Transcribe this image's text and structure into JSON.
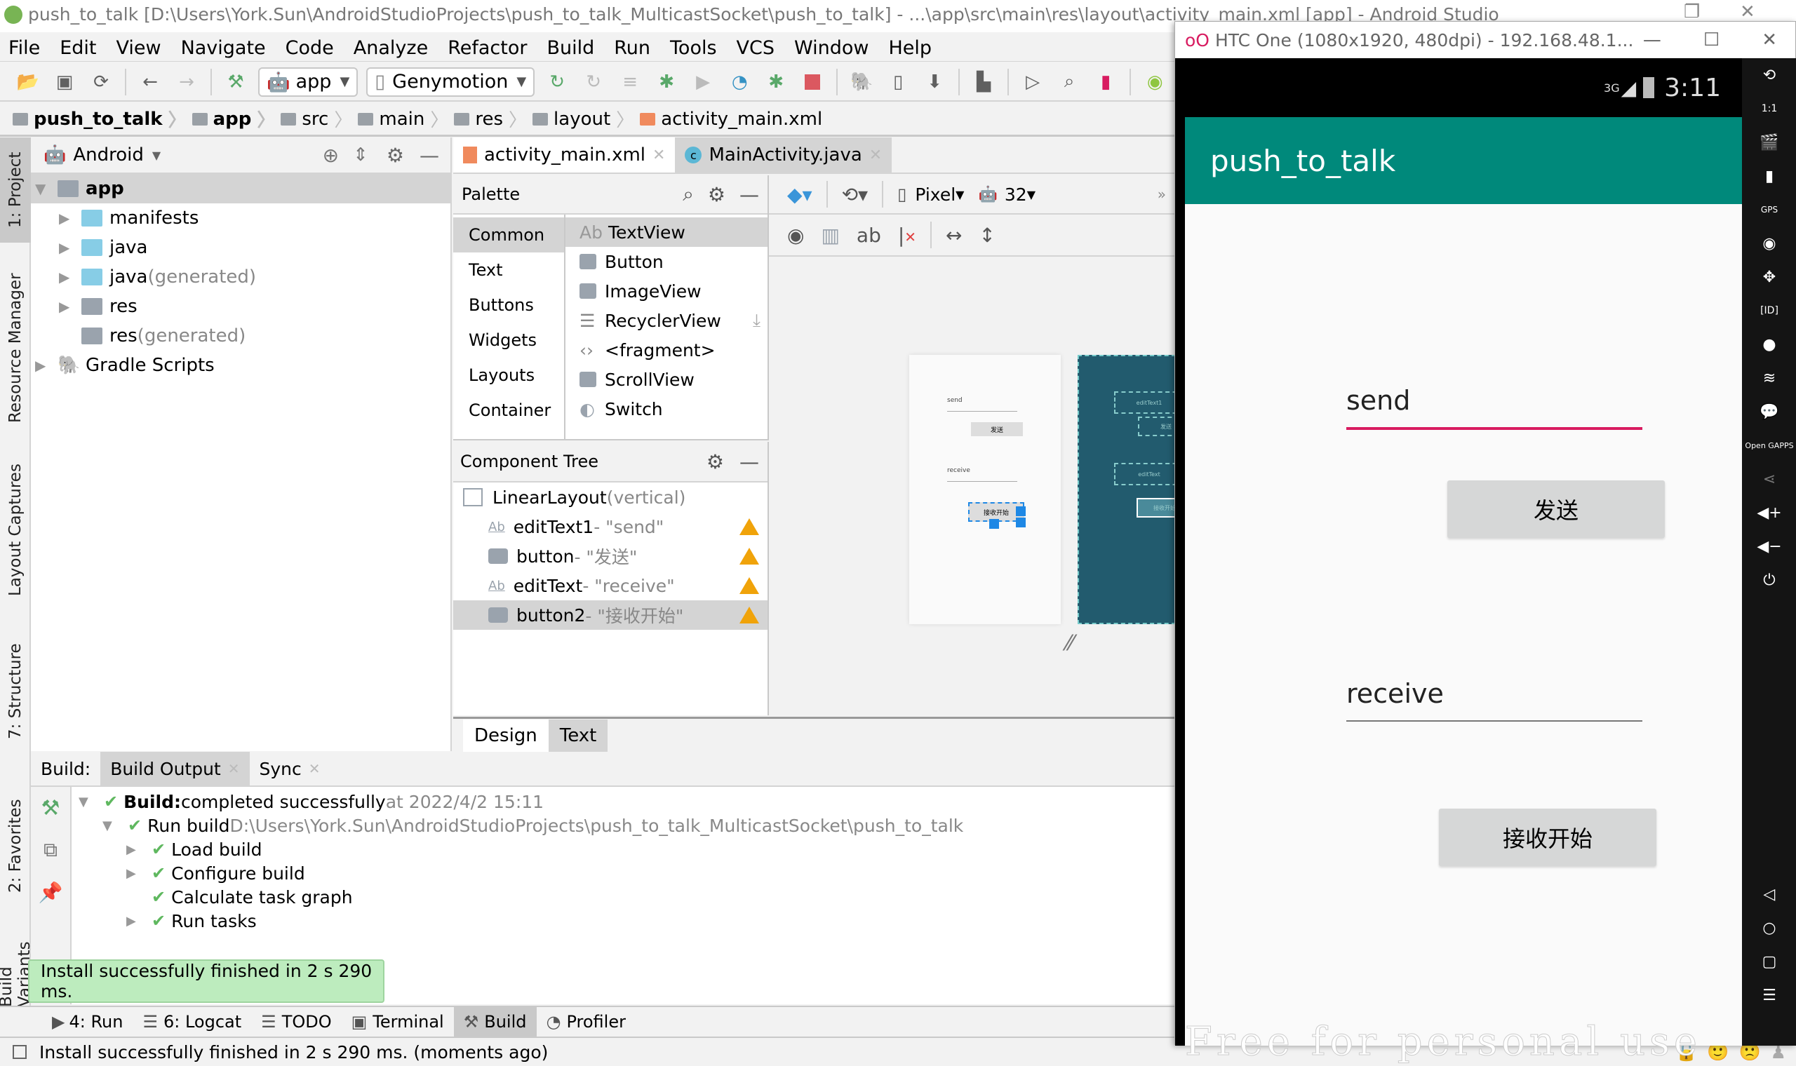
{
  "window": {
    "title": "push_to_talk [D:\\Users\\York.Sun\\AndroidStudioProjects\\push_to_talk_MulticastSocket\\push_to_talk] - ...\\app\\src\\main\\res\\layout\\activity_main.xml [app] - Android Studio"
  },
  "menu": [
    "File",
    "Edit",
    "View",
    "Navigate",
    "Code",
    "Analyze",
    "Refactor",
    "Build",
    "Run",
    "Tools",
    "VCS",
    "Window",
    "Help"
  ],
  "toolbar": {
    "run_config": "app",
    "device": "Genymotion",
    "icons": [
      "open-icon",
      "save-icon",
      "sync-icon",
      "back-icon",
      "forward-icon",
      "build-hammer-icon",
      "apply-changes-icon",
      "apply-code-changes-icon",
      "attach-icon",
      "debug-icon",
      "run-coverage-icon",
      "profile-icon",
      "attach-debugger-icon",
      "stop-icon",
      "gradle-sync-icon",
      "avd-manager-icon",
      "sdk-manager-icon",
      "project-structure-icon",
      "terminal-run-icon",
      "search-icon",
      "device-file-explorer-icon",
      "android-assistant-icon"
    ]
  },
  "breadcrumb": [
    "push_to_talk",
    "app",
    "src",
    "main",
    "res",
    "layout",
    "activity_main.xml"
  ],
  "left_stripe": [
    "1: Project",
    "Resource Manager",
    "Layout Captures",
    "7: Structure",
    "2: Favorites",
    "Build Variants"
  ],
  "project": {
    "view": "Android",
    "tree": [
      {
        "label": "app",
        "suffix": "",
        "level": 0,
        "expanded": true,
        "bold": true,
        "selected": true
      },
      {
        "label": "manifests",
        "suffix": "",
        "level": 1,
        "expanded": false
      },
      {
        "label": "java",
        "suffix": "",
        "level": 1,
        "expanded": false
      },
      {
        "label": "java",
        "suffix": " (generated)",
        "level": 1,
        "expanded": false
      },
      {
        "label": "res",
        "suffix": "",
        "level": 1,
        "expanded": false
      },
      {
        "label": "res",
        "suffix": " (generated)",
        "level": 1,
        "leaf": true
      },
      {
        "label": "Gradle Scripts",
        "suffix": "",
        "level": 0,
        "expanded": false
      }
    ]
  },
  "editor_tabs": [
    {
      "label": "activity_main.xml",
      "active": true
    },
    {
      "label": "MainActivity.java",
      "active": false
    }
  ],
  "palette": {
    "title": "Palette",
    "categories": [
      "Common",
      "Text",
      "Buttons",
      "Widgets",
      "Layouts",
      "Container"
    ],
    "active_category": "Common",
    "items": [
      "TextView",
      "Button",
      "ImageView",
      "RecyclerView",
      "<fragment>",
      "ScrollView",
      "Switch"
    ]
  },
  "design_toolbar": {
    "device": "Pixel",
    "api": "32"
  },
  "component_tree": {
    "title": "Component Tree",
    "root": {
      "name": "LinearLayout",
      "detail": "(vertical)"
    },
    "children": [
      {
        "name": "editText1",
        "detail": "- \"send\"",
        "type": "edittext",
        "warning": true
      },
      {
        "name": "button",
        "detail": "- \"发送\"",
        "type": "button",
        "warning": true
      },
      {
        "name": "editText",
        "detail": "- \"receive\"",
        "type": "edittext",
        "warning": true
      },
      {
        "name": "button2",
        "detail": "- \"接收开始\"",
        "type": "button",
        "warning": true,
        "selected": true
      }
    ]
  },
  "preview": {
    "design": {
      "send": "send",
      "send_btn": "发送",
      "receive": "receive",
      "recv_btn": "接收开始"
    },
    "blueprint": {
      "edit1": "editText1",
      "btn1": "发送",
      "edit2": "editText",
      "btn2": "接收开始"
    }
  },
  "design_tabs": [
    "Design",
    "Text"
  ],
  "build": {
    "label": "Build:",
    "tabs": [
      "Build Output",
      "Sync"
    ],
    "lines": [
      {
        "bold": "Build:",
        "text": " completed successfully",
        "gray": " at 2022/4/2 15:11",
        "indent": 0,
        "tri": "down"
      },
      {
        "bold": "",
        "text": "Run build ",
        "gray": "D:\\Users\\York.Sun\\AndroidStudioProjects\\push_to_talk_MulticastSocket\\push_to_talk",
        "indent": 1,
        "tri": "down"
      },
      {
        "bold": "",
        "text": "Load build",
        "gray": "",
        "indent": 2,
        "tri": "right"
      },
      {
        "bold": "",
        "text": "Configure build",
        "gray": "",
        "indent": 2,
        "tri": "right"
      },
      {
        "bold": "",
        "text": "Calculate task graph",
        "gray": "",
        "indent": 2,
        "tri": ""
      },
      {
        "bold": "",
        "text": "Run tasks",
        "gray": "",
        "indent": 2,
        "tri": "right"
      }
    ]
  },
  "toast": "Install successfully finished in 2 s 290 ms.",
  "bottom_tabs": [
    {
      "label": "4: Run",
      "active": false
    },
    {
      "label": "6: Logcat",
      "active": false
    },
    {
      "label": "TODO",
      "active": false
    },
    {
      "label": "Terminal",
      "active": false
    },
    {
      "label": "Build",
      "active": true
    },
    {
      "label": "Profiler",
      "active": false
    }
  ],
  "status": "Install successfully finished in 2 s 290 ms. (moments ago)",
  "emulator": {
    "title": "HTC One (1080x1920, 480dpi) - 192.168.48.1...",
    "network": "3G",
    "clock": "3:11",
    "app_title": "push_to_talk",
    "send_field": "send",
    "send_button": "发送",
    "receive_field": "receive",
    "receive_button": "接收开始",
    "watermark": "Free for personal use",
    "accent_color": "#d81b60",
    "appbar_color": "#00897b",
    "side_icons": [
      "rotate-icon",
      "pixel-perfect-icon",
      "capture-icon",
      "battery-icon",
      "gps-icon",
      "camera-icon",
      "dpad-icon",
      "device-id-icon",
      "disk-io-icon",
      "network-icon",
      "sms-icon",
      "open-gapps-icon",
      "share-icon",
      "volume-up-icon",
      "volume-down-icon",
      "power-icon",
      "back-icon",
      "home-icon",
      "recents-icon",
      "menu-icon"
    ]
  }
}
